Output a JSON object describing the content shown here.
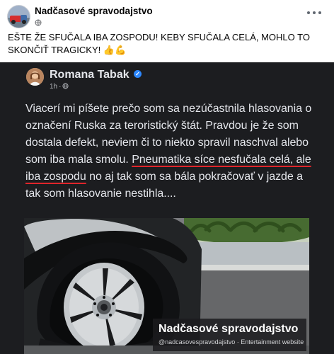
{
  "post": {
    "page_name": "Nadčasové spravodajstvo",
    "caption": "EŠTE ŽE SFUČALA IBA ZOSPODU! KEBY SFUČALA CELÁ, MOHLO TO SKONČIŤ TRAGICKY!",
    "caption_emojis": "👍💪"
  },
  "embedded_post": {
    "author_name": "Romana Tabak",
    "time": "1h",
    "text_before_underline": "Viacerí mi píšete prečo som sa nezúčastnila hlasovania o označení Ruska za teroristický štát. Pravdou je že som dostala defekt, neviem či to niekto spravil naschval alebo som iba mala smolu.",
    "text_underlined": "Pneumatika síce nesfučala celá, ale iba zospodu",
    "text_after_underline": " no aj tak som sa bála pokračovať v jazde a tak som hlasovanie nestihla...."
  },
  "watermark": {
    "title": "Nadčasové spravodajstvo",
    "subtitle": "@nadcasovespravodajstvo · Entertainment website"
  },
  "colors": {
    "embedded_background": "#1c1d20",
    "underline": "#e0252b",
    "verified": "#2d88ff"
  }
}
